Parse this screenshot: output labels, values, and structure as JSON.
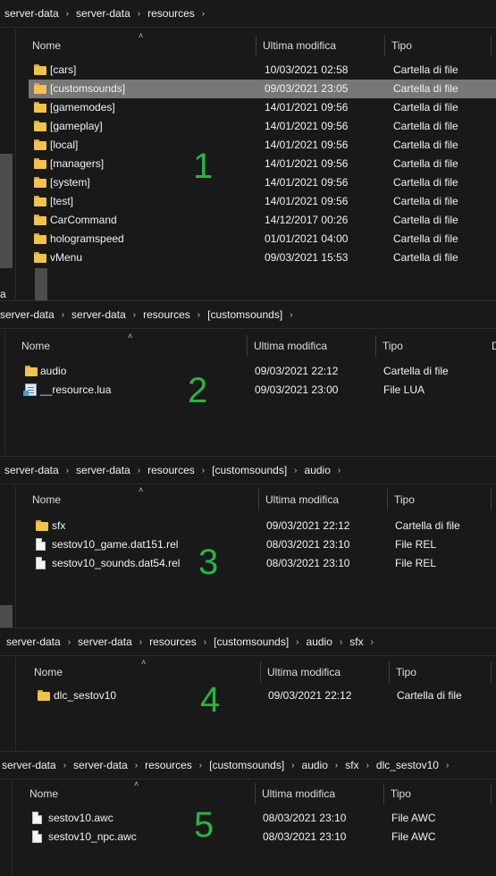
{
  "columns": {
    "name": "Nome",
    "modified": "Ultima modifica",
    "type": "Tipo",
    "size": "D"
  },
  "sort_icon": "chevron-up-icon",
  "panels": [
    {
      "label": "1",
      "breadcrumb": [
        "server-data",
        "server-data",
        "resources"
      ],
      "left_label": "a",
      "rows": [
        {
          "name": "[cars]",
          "modified": "10/03/2021 02:58",
          "type": "Cartella di file",
          "icon": "folder-icon"
        },
        {
          "name": "[customsounds]",
          "modified": "09/03/2021 23:05",
          "type": "Cartella di file",
          "icon": "folder-icon",
          "selected": true
        },
        {
          "name": "[gamemodes]",
          "modified": "14/01/2021 09:56",
          "type": "Cartella di file",
          "icon": "folder-icon"
        },
        {
          "name": "[gameplay]",
          "modified": "14/01/2021 09:56",
          "type": "Cartella di file",
          "icon": "folder-icon"
        },
        {
          "name": "[local]",
          "modified": "14/01/2021 09:56",
          "type": "Cartella di file",
          "icon": "folder-icon"
        },
        {
          "name": "[managers]",
          "modified": "14/01/2021 09:56",
          "type": "Cartella di file",
          "icon": "folder-icon"
        },
        {
          "name": "[system]",
          "modified": "14/01/2021 09:56",
          "type": "Cartella di file",
          "icon": "folder-icon"
        },
        {
          "name": "[test]",
          "modified": "14/01/2021 09:56",
          "type": "Cartella di file",
          "icon": "folder-icon"
        },
        {
          "name": "CarCommand",
          "modified": "14/12/2017 00:26",
          "type": "Cartella di file",
          "icon": "folder-icon"
        },
        {
          "name": "hologramspeed",
          "modified": "01/01/2021 04:00",
          "type": "Cartella di file",
          "icon": "folder-icon"
        },
        {
          "name": "vMenu",
          "modified": "09/03/2021 15:53",
          "type": "Cartella di file",
          "icon": "folder-icon"
        }
      ]
    },
    {
      "label": "2",
      "breadcrumb": [
        "server-data",
        "server-data",
        "resources",
        "[customsounds]"
      ],
      "rows": [
        {
          "name": "audio",
          "modified": "09/03/2021 22:12",
          "type": "Cartella di file",
          "icon": "folder-icon"
        },
        {
          "name": "__resource.lua",
          "modified": "09/03/2021 23:00",
          "type": "File LUA",
          "icon": "lua-file-icon"
        }
      ]
    },
    {
      "label": "3",
      "breadcrumb": [
        "server-data",
        "server-data",
        "resources",
        "[customsounds]",
        "audio"
      ],
      "rows": [
        {
          "name": "sfx",
          "modified": "09/03/2021 22:12",
          "type": "Cartella di file",
          "icon": "folder-icon"
        },
        {
          "name": "sestov10_game.dat151.rel",
          "modified": "08/03/2021 23:10",
          "type": "File REL",
          "icon": "file-icon"
        },
        {
          "name": "sestov10_sounds.dat54.rel",
          "modified": "08/03/2021 23:10",
          "type": "File REL",
          "icon": "file-icon"
        }
      ]
    },
    {
      "label": "4",
      "breadcrumb": [
        "server-data",
        "server-data",
        "resources",
        "[customsounds]",
        "audio",
        "sfx"
      ],
      "rows": [
        {
          "name": "dlc_sestov10",
          "modified": "09/03/2021 22:12",
          "type": "Cartella di file",
          "icon": "folder-icon"
        }
      ]
    },
    {
      "label": "5",
      "breadcrumb": [
        "server-data",
        "server-data",
        "resources",
        "[customsounds]",
        "audio",
        "sfx",
        "dlc_sestov10"
      ],
      "rows": [
        {
          "name": "sestov10.awc",
          "modified": "08/03/2021 23:10",
          "type": "File AWC",
          "icon": "file-icon"
        },
        {
          "name": "sestov10_npc.awc",
          "modified": "08/03/2021 23:10",
          "type": "File AWC",
          "icon": "file-icon"
        }
      ]
    }
  ]
}
